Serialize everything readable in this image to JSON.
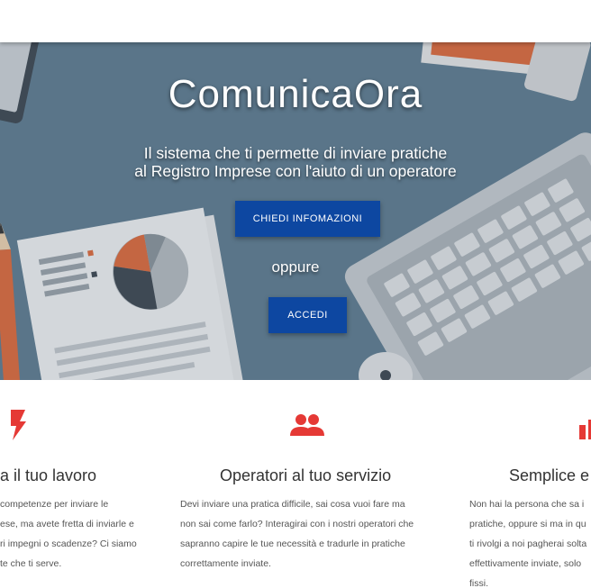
{
  "hero": {
    "title": "ComunicaOra",
    "subtitle_line1": "Il sistema che ti permette di inviare pratiche",
    "subtitle_line2": "al Registro Imprese con l'aiuto di un operatore",
    "info_button": "CHIEDI INFOMAZIONI",
    "or_text": "oppure",
    "login_button": "ACCEDI"
  },
  "features": [
    {
      "icon": "lightning-bolt-icon",
      "title": "a il tuo lavoro",
      "lines": [
        "competenze per inviare le",
        "ese, ma avete fretta di inviarle e",
        "ri impegni o scadenze? Ci siamo",
        "te che ti serve."
      ]
    },
    {
      "icon": "people-icon",
      "title": "Operatori al tuo servizio",
      "lines": [
        "Devi inviare una pratica difficile, sai cosa vuoi fare ma",
        "non sai come farlo? Interagirai con i nostri operatori che",
        "sapranno capire le tue necessità e tradurle in pratiche",
        "correttamente inviate."
      ]
    },
    {
      "icon": "chart-bars-icon",
      "title": "Semplice e",
      "lines": [
        "Non hai la persona che sa i",
        "pratiche, oppure si ma in qu",
        "ti rivolgi a noi pagherai solta",
        "effettivamente inviate, solo",
        "fissi."
      ]
    }
  ],
  "colors": {
    "accent_red": "#e53935",
    "button_blue": "#0d47a1"
  }
}
